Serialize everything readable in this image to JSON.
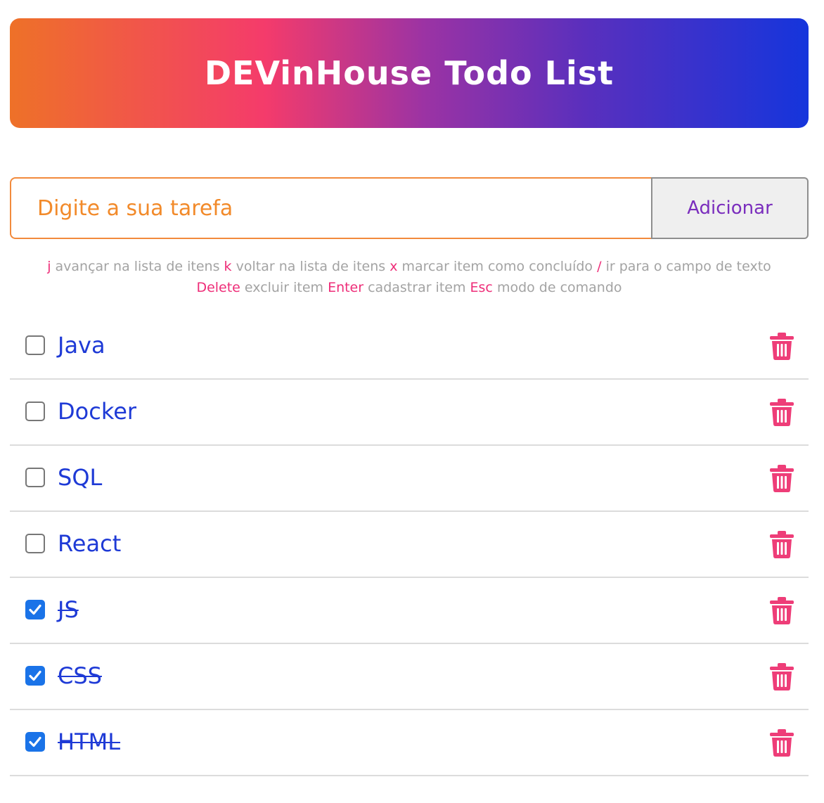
{
  "header": {
    "title": "DEVinHouse Todo List"
  },
  "form": {
    "placeholder": "Digite a sua tarefa",
    "value": "",
    "add_label": "Adicionar"
  },
  "shortcuts": {
    "line1": [
      {
        "key": "j",
        "desc": "avançar na lista de itens"
      },
      {
        "key": "k",
        "desc": "voltar na lista de itens"
      },
      {
        "key": "x",
        "desc": "marcar item como concluído"
      },
      {
        "key": "/",
        "desc": "ir para o campo de texto"
      }
    ],
    "line2": [
      {
        "key": "Delete",
        "desc": "excluir item"
      },
      {
        "key": "Enter",
        "desc": "cadastrar item"
      },
      {
        "key": "Esc",
        "desc": "modo de comando"
      }
    ]
  },
  "todos": [
    {
      "label": "Java",
      "done": false
    },
    {
      "label": "Docker",
      "done": false
    },
    {
      "label": "SQL",
      "done": false
    },
    {
      "label": "React",
      "done": false
    },
    {
      "label": "JS",
      "done": true
    },
    {
      "label": "CSS",
      "done": true
    },
    {
      "label": "HTML",
      "done": true
    }
  ],
  "icons": {
    "checkbox": "checkbox-icon",
    "delete": "trash-icon"
  },
  "colors": {
    "gradient_start": "#ee7128",
    "gradient_mid": "#f43b6b",
    "gradient_end": "#1535dc",
    "input_accent": "#f28a2a",
    "button_text": "#7a2dbd",
    "shortcut_key": "#ee2d78",
    "shortcut_text": "#a3a3a3",
    "todo_text": "#1e3ad6",
    "checked_box": "#1a73e8",
    "delete_icon": "#ee3d78"
  }
}
